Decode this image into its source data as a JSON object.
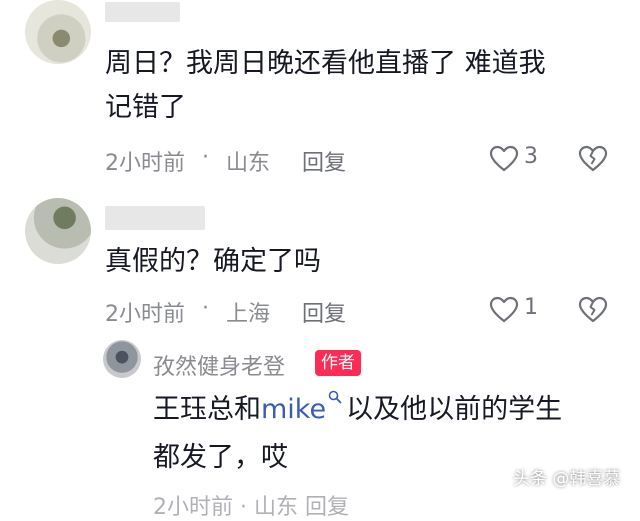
{
  "comment1": {
    "text_line1": "周日？我周日晚还看他直播了 难道我",
    "text_line2": "记错了",
    "time": "2小时前",
    "sep": "·",
    "location": "山东",
    "reply_label": "回复",
    "likes": "3"
  },
  "comment2": {
    "text": "真假的？确定了吗",
    "time": "2小时前",
    "sep": "·",
    "location": "上海",
    "reply_label": "回复",
    "likes": "1"
  },
  "reply": {
    "author": "孜然健身老登",
    "badge": "作者",
    "text_prefix": "王珏总和",
    "mention": "mike",
    "text_suffix": "以及他以前的学生",
    "text_line2": "都发了，哎",
    "partial_meta": "2小时前 · 山东 回复"
  },
  "watermark": "头条 @韩喜慕",
  "colors": {
    "accent": "#fe2c55",
    "mention": "#3b5bb7",
    "meta": "#8a8b91"
  }
}
